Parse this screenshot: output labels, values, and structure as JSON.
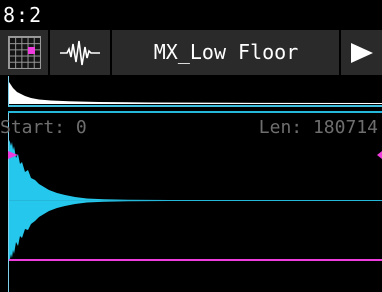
{
  "status": {
    "clock": "8:2"
  },
  "toolbar": {
    "grid_icon": "grid-icon",
    "wave_icon": "waveform-icon",
    "sample_name": "MX_Low Floor",
    "play_icon": "play-icon"
  },
  "editor": {
    "start_label": "Start:",
    "start_value": "0",
    "length_label": "Len:",
    "length_value": "180714"
  },
  "colors": {
    "background": "#000000",
    "toolbar": "#2a2a2a",
    "waveform": "#25c8ec",
    "overview_wave": "#ffffff",
    "marker": "#ee3ddc",
    "text_dim": "#6e6e6e",
    "text": "#ffffff"
  }
}
